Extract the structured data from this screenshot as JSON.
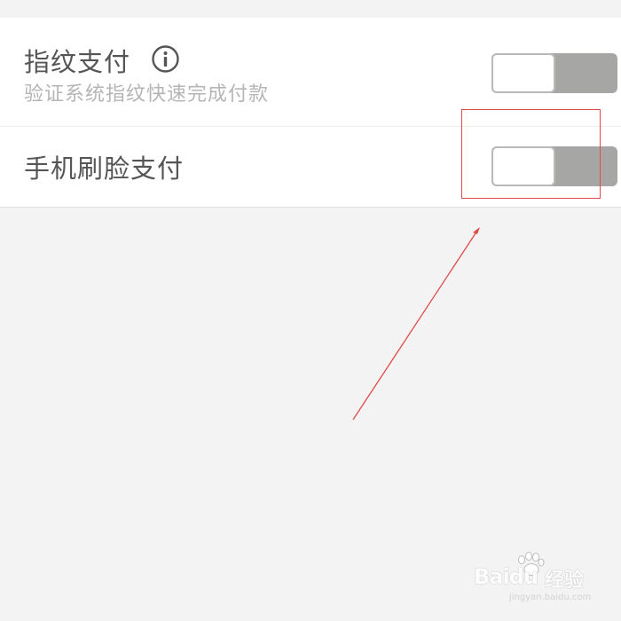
{
  "settings": {
    "fingerprint": {
      "title": "指纹支付",
      "subtitle": "验证系统指纹快速完成付款",
      "info_icon": "info-circle-icon",
      "toggle_state": "off"
    },
    "face": {
      "title": "手机刷脸支付",
      "toggle_state": "off"
    }
  },
  "annotation": {
    "color": "#e04a4a",
    "shape": "rectangle-with-arrow"
  },
  "watermark": {
    "brand": "Bai",
    "brand_du": "du",
    "suffix": "经验",
    "url": "jingyan.baidu.com"
  },
  "colors": {
    "background": "#f3f3f3",
    "card": "#ffffff",
    "toggle_track": "#a6a7a4",
    "title_text": "#555555",
    "subtitle_text": "#b5b5b5"
  }
}
